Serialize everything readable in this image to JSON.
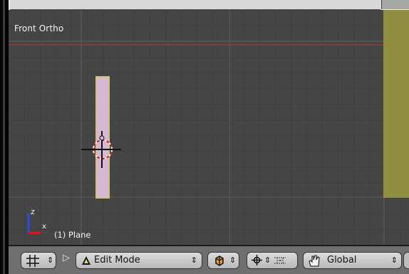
{
  "viewport": {
    "title": "Front Ortho",
    "object_label": "(1) Plane",
    "axes": {
      "z": "z",
      "x": "x"
    }
  },
  "header": {
    "grid_button_icon": "grid-icon",
    "toggle_icon": "triangle-right-icon",
    "mode_select": {
      "value": "Edit Mode",
      "icon": "triangle-mesh-icon"
    },
    "shading_button_icon": "solid-cube-icon",
    "pivot_button_icon": "pivot-crosshair-icon",
    "snap_button_icon": "snap-icon",
    "transform_select": {
      "value": "Global",
      "icon": "hand-icon"
    },
    "arrows_glyph": "⇕"
  },
  "colors": {
    "viewport_bg": "#454545",
    "grid_minor": "#3b3b3b",
    "grid_major": "#5f5f5f",
    "red_axis": "#b03a3a",
    "plane_fill": "#d6b7d4",
    "plane_edge": "#d4c27b",
    "olive_object": "#8f8f3f",
    "header_bg": "#6f6f6f"
  }
}
